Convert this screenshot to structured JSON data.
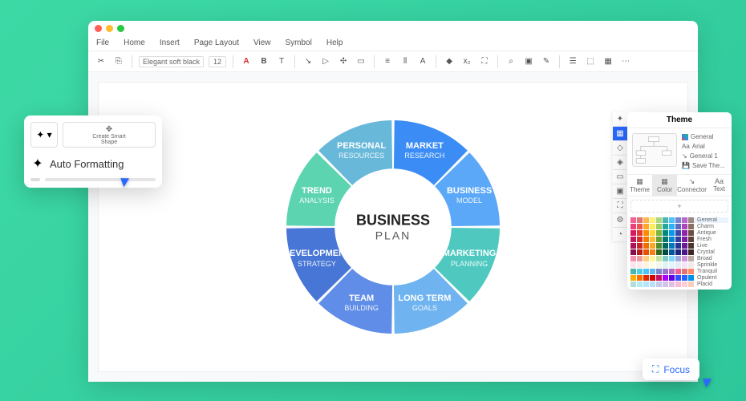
{
  "menu": [
    "File",
    "Home",
    "Insert",
    "Page Layout",
    "View",
    "Symbol",
    "Help"
  ],
  "toolbar": {
    "font": "Elegant soft black",
    "size": "12"
  },
  "auto_pop": {
    "create_smart_shape": "Create Smart\nShape",
    "auto_formatting": "Auto Formatting"
  },
  "focus": {
    "label": "Focus"
  },
  "theme": {
    "title": "Theme",
    "opt_general": "General",
    "opt_arial": "Arial",
    "opt_general1": "General 1",
    "opt_save": "Save The...",
    "tabs": [
      "Theme",
      "Color",
      "Connector",
      "Text"
    ],
    "palettes": [
      "General",
      "Charm",
      "Antique",
      "Fresh",
      "Live",
      "Crystal",
      "Broad",
      "Sprinkle",
      "Tranquil",
      "Opulent",
      "Placid"
    ]
  },
  "donut": {
    "center_title": "BUSINESS",
    "center_sub": "PLAN",
    "segments": [
      {
        "title": "MARKET",
        "sub": "RESEARCH",
        "color": "#3b8df5"
      },
      {
        "title": "BUSINESS",
        "sub": "MODEL",
        "color": "#5aa8f7"
      },
      {
        "title": "MARKETING",
        "sub": "PLANNING",
        "color": "#4fc9c0"
      },
      {
        "title": "LONG TERM",
        "sub": "GOALS",
        "color": "#6fb4f0"
      },
      {
        "title": "TEAM",
        "sub": "BUILDING",
        "color": "#5f8de8"
      },
      {
        "title": "DEVELOPMENT",
        "sub": "STRATEGY",
        "color": "#4876d6"
      },
      {
        "title": "TREND",
        "sub": "ANALYSIS",
        "color": "#5dd4b0"
      },
      {
        "title": "PERSONAL",
        "sub": "RESOURCES",
        "color": "#67b8d9"
      }
    ]
  },
  "palette_colors": [
    [
      "#f06292",
      "#e57373",
      "#ffb74d",
      "#fff176",
      "#aed581",
      "#4db6ac",
      "#4fc3f7",
      "#7986cb",
      "#ba68c8",
      "#a1887f"
    ],
    [
      "#ec407a",
      "#ef5350",
      "#ffa726",
      "#ffee58",
      "#9ccc65",
      "#26a69a",
      "#29b6f6",
      "#5c6bc0",
      "#ab47bc",
      "#8d6e63"
    ],
    [
      "#d81b60",
      "#e53935",
      "#fb8c00",
      "#fdd835",
      "#7cb342",
      "#00897b",
      "#039be5",
      "#3949ab",
      "#8e24aa",
      "#6d4c41"
    ],
    [
      "#c2185b",
      "#d32f2f",
      "#f57c00",
      "#fbc02d",
      "#689f38",
      "#00796b",
      "#0288d1",
      "#303f9f",
      "#7b1fa2",
      "#5d4037"
    ],
    [
      "#ad1457",
      "#c62828",
      "#ef6c00",
      "#f9a825",
      "#558b2f",
      "#00695c",
      "#0277bd",
      "#283593",
      "#6a1b9a",
      "#4e342e"
    ],
    [
      "#880e4f",
      "#b71c1c",
      "#e65100",
      "#f57f17",
      "#33691e",
      "#004d40",
      "#01579b",
      "#1a237e",
      "#4a148c",
      "#3e2723"
    ],
    [
      "#f48fb1",
      "#ef9a9a",
      "#ffcc80",
      "#fff59d",
      "#c5e1a5",
      "#80cbc4",
      "#81d4fa",
      "#9fa8da",
      "#ce93d8",
      "#bcaaa4"
    ],
    [
      "#fce4ec",
      "#ffebee",
      "#fff3e0",
      "#fffde7",
      "#f1f8e9",
      "#e0f2f1",
      "#e1f5fe",
      "#e8eaf6",
      "#f3e5f5",
      "#efebe9"
    ],
    [
      "#4db6ac",
      "#4dd0e1",
      "#4fc3f7",
      "#64b5f6",
      "#7986cb",
      "#9575cd",
      "#ba68c8",
      "#f06292",
      "#e57373",
      "#ff8a65"
    ],
    [
      "#ffab00",
      "#ff6f00",
      "#dd2c00",
      "#d50000",
      "#c51162",
      "#aa00ff",
      "#6200ea",
      "#304ffe",
      "#2962ff",
      "#0091ea"
    ],
    [
      "#b2dfdb",
      "#b2ebf2",
      "#b3e5fc",
      "#bbdefb",
      "#c5cae9",
      "#d1c4e9",
      "#e1bee7",
      "#f8bbd0",
      "#ffcdd2",
      "#ffccbc"
    ]
  ]
}
